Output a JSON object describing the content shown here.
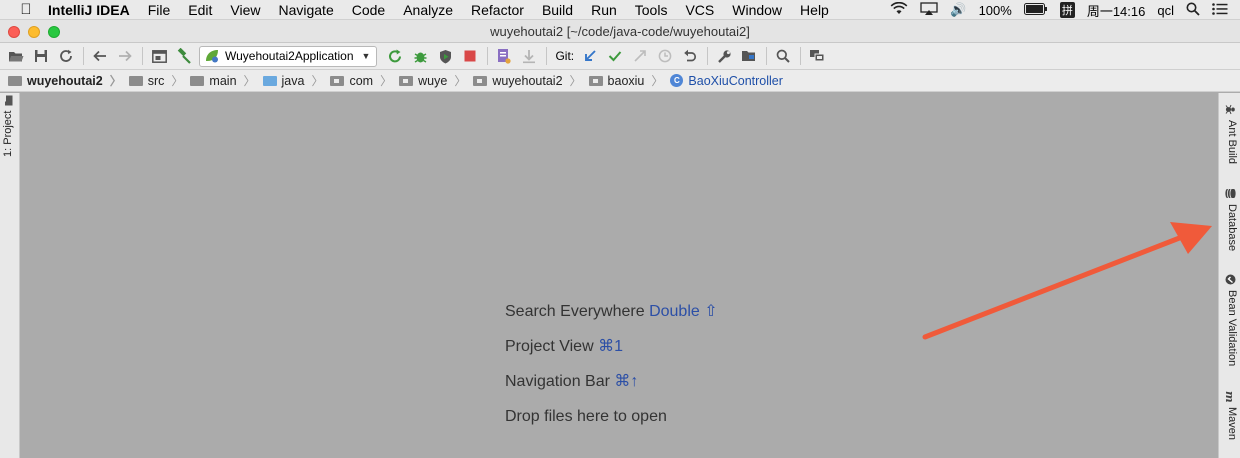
{
  "menubar": {
    "app_name": "IntelliJ IDEA",
    "items": [
      "File",
      "Edit",
      "View",
      "Navigate",
      "Code",
      "Analyze",
      "Refactor",
      "Build",
      "Run",
      "Tools",
      "VCS",
      "Window",
      "Help"
    ],
    "battery": "100%",
    "input_method": "拼",
    "clock": "周一14:16",
    "user": "qcl"
  },
  "window": {
    "title": "wuyehoutai2 [~/code/java-code/wuyehoutai2]"
  },
  "toolbar": {
    "run_config": "Wuyehoutai2Application",
    "git_label": "Git:"
  },
  "breadcrumb": {
    "items": [
      "wuyehoutai2",
      "src",
      "main",
      "java",
      "com",
      "wuye",
      "wuyehoutai2",
      "baoxiu"
    ],
    "class_badge": "C",
    "class_name": "BaoXiuController"
  },
  "left_tabs": {
    "project": "1: Project"
  },
  "right_tabs": {
    "ant_build": "Ant Build",
    "database": "Database",
    "bean_validation": "Bean Validation",
    "maven": "Maven"
  },
  "editor_hints": [
    {
      "label": "Search Everywhere",
      "shortcut": "Double ⇧"
    },
    {
      "label": "Project View",
      "shortcut": "⌘1"
    },
    {
      "label": "Navigation Bar",
      "shortcut": "⌘↑"
    },
    {
      "label": "Drop files here to open",
      "shortcut": ""
    }
  ],
  "colors": {
    "annotation_arrow": "#f05a3a",
    "link_blue": "#2c4fa6"
  }
}
